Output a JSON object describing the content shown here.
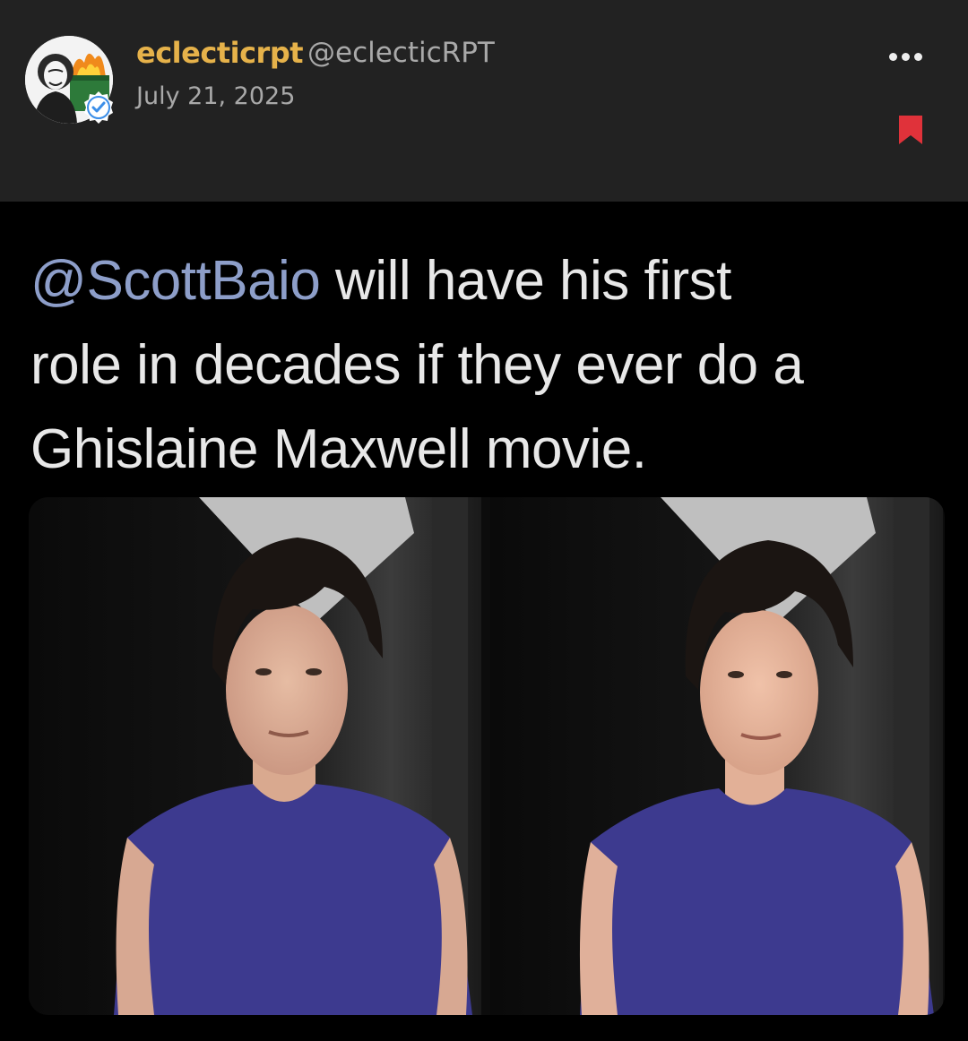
{
  "author": {
    "display_name": "eclecticrpt",
    "handle": "@eclecticRPT",
    "date": "July 21, 2025",
    "verified": true,
    "avatar_icon": "masked-figure-dumpster-fire-avatar",
    "verified_icon": "verified-badge-icon"
  },
  "actions": {
    "more_icon": "more-options-icon",
    "bookmark_icon": "bookmark-icon"
  },
  "tweet": {
    "mention": "@ScottBaio",
    "text_line1_rest": " will have his first",
    "text_line2": "role in decades if they ever do a",
    "text_line3": "Ghislaine Maxwell movie."
  },
  "images": {
    "left_icon": "photo-man-dark-hair-blue-sleeveless-top",
    "right_icon": "photo-woman-dark-hair-blue-sleeveless-top"
  },
  "colors": {
    "username": "#e6b24a",
    "mention": "#8d9ec9",
    "bookmark": "#e0323a",
    "verified": "#3b8ee8",
    "shirt": "#3d3a8f"
  }
}
